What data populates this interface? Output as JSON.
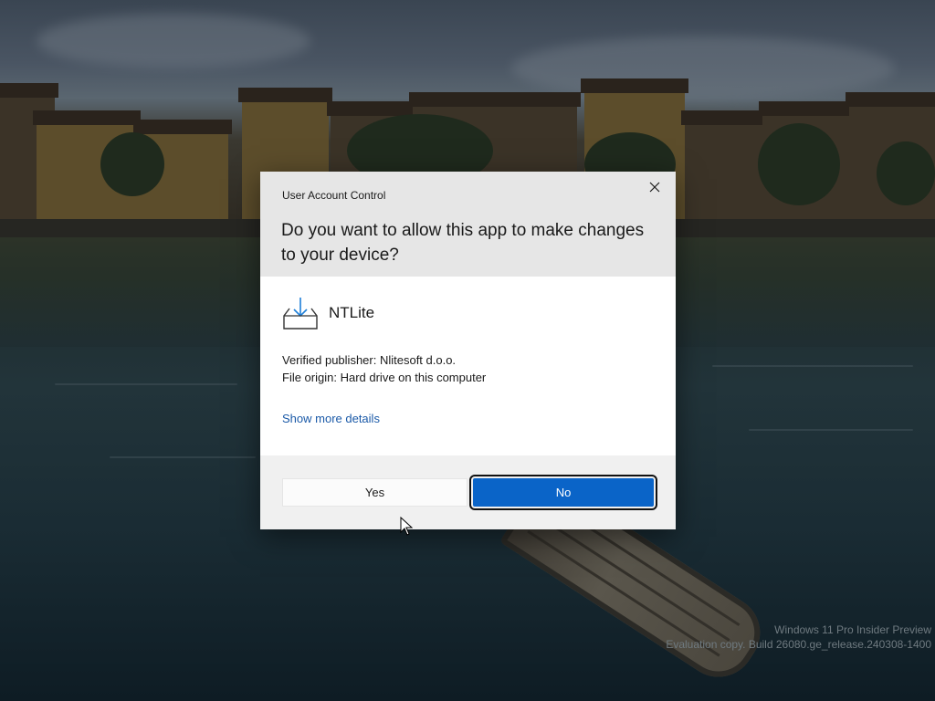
{
  "dialog": {
    "title": "User Account Control",
    "question": "Do you want to allow this app to make changes to your device?",
    "app_name": "NTLite",
    "app_icon": "download-tray-icon",
    "publisher": "Verified publisher: Nlitesoft d.o.o.",
    "origin": "File origin: Hard drive on this computer",
    "details_link": "Show more details",
    "yes_label": "Yes",
    "no_label": "No",
    "close_icon": "close-icon"
  },
  "watermark": {
    "line1": "Windows 11 Pro Insider Preview",
    "line2": "Evaluation copy. Build 26080.ge_release.240308-1400"
  },
  "colors": {
    "accent": "#0a64c8",
    "link": "#1b5aa8",
    "header_bg": "#e6e6e6",
    "footer_bg": "#f0f0f0"
  }
}
